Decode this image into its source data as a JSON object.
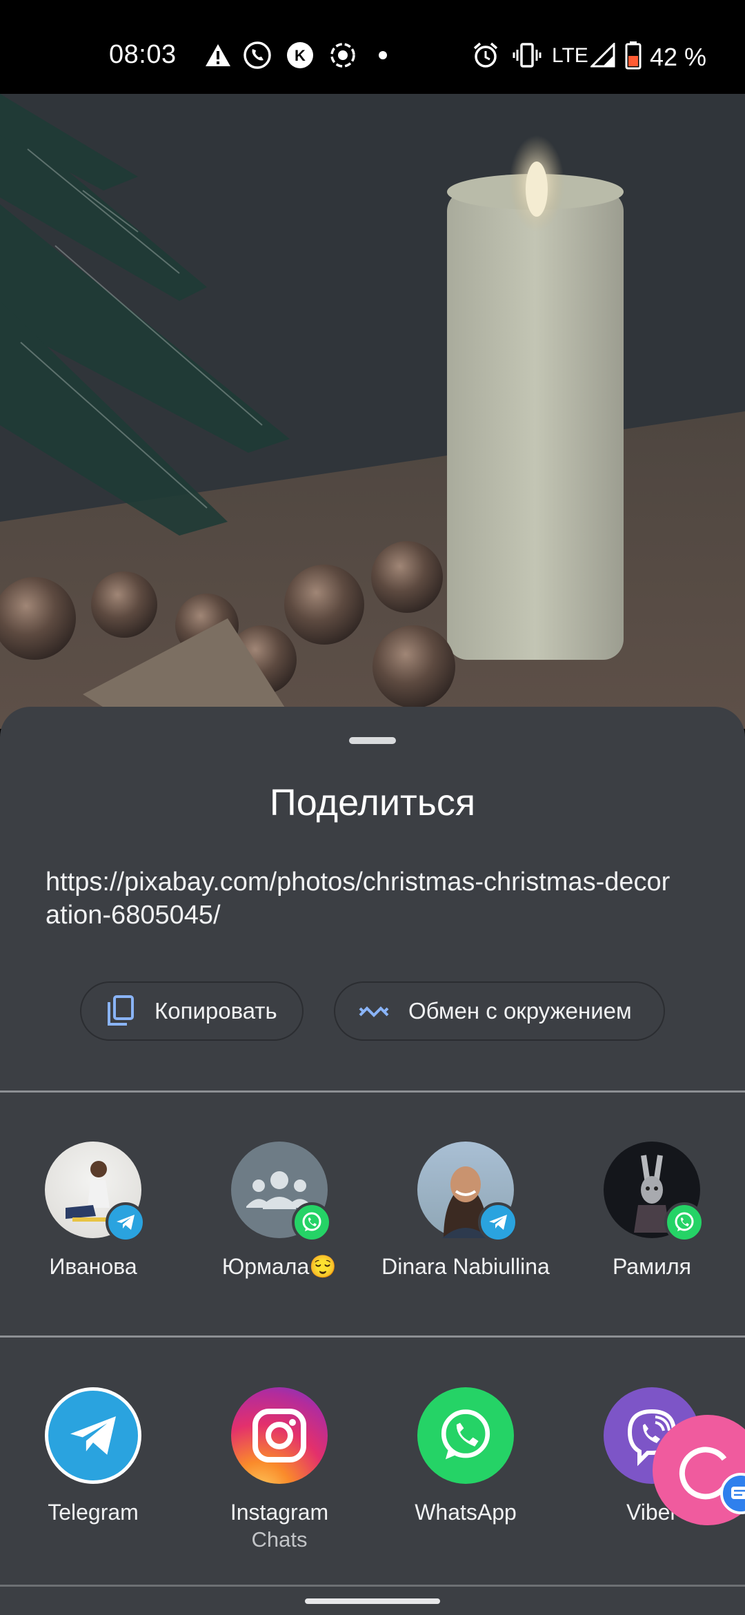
{
  "status_bar": {
    "time": "08:03",
    "network": "LTE",
    "battery": "42 %",
    "icons": [
      "warning-icon",
      "call-icon",
      "k-app-icon",
      "screen-record-icon",
      "dot-icon",
      "alarm-icon",
      "vibrate-icon",
      "signal-icon",
      "battery-low-icon"
    ]
  },
  "sheet": {
    "title": "Поделиться",
    "url": "https://pixabay.com/photos/christmas-christmas-decoration-6805045/",
    "actions": [
      {
        "label": "Копировать",
        "icon": "copy-icon"
      },
      {
        "label": "Обмен с окружением",
        "icon": "nearby-share-icon"
      }
    ]
  },
  "contacts": [
    {
      "name": "Иванова",
      "app": "telegram"
    },
    {
      "name": "Юрмала😌",
      "app": "whatsapp"
    },
    {
      "name": "Dinara Nabiullina",
      "app": "telegram"
    },
    {
      "name": "Рамиля",
      "app": "whatsapp"
    }
  ],
  "apps": [
    {
      "name": "Telegram",
      "sub": ""
    },
    {
      "name": "Instagram",
      "sub": "Chats"
    },
    {
      "name": "WhatsApp",
      "sub": ""
    },
    {
      "name": "Viber",
      "sub": ""
    }
  ],
  "colors": {
    "sheet_bg": "#3c3f44",
    "telegram": "#2aa3df",
    "whatsapp": "#25d366",
    "viber": "#7d55c7",
    "fab": "#f05b9e"
  }
}
